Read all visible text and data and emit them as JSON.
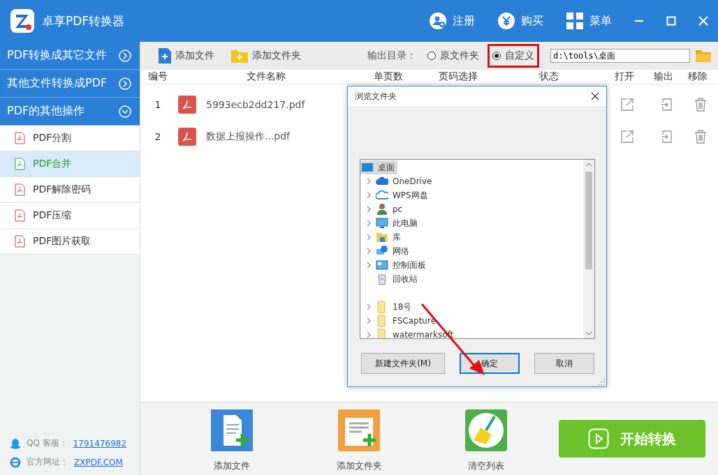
{
  "window": {
    "title": "卓享PDF转换器",
    "actions": [
      {
        "kind": "register",
        "label": "注册"
      },
      {
        "kind": "buy",
        "label": "购买"
      },
      {
        "kind": "menu",
        "label": "菜单"
      }
    ]
  },
  "sidebar": {
    "groups": [
      {
        "label": "PDF转换成其它文件",
        "expanded": false
      },
      {
        "label": "其他文件转换成PDF",
        "expanded": false
      },
      {
        "label": "PDF的其他操作",
        "expanded": true,
        "items": [
          {
            "label": "PDF分割",
            "selected": false
          },
          {
            "label": "PDF合并",
            "selected": true
          },
          {
            "label": "PDF解除密码",
            "selected": false
          },
          {
            "label": "PDF压缩",
            "selected": false
          },
          {
            "label": "PDF图片获取",
            "selected": false
          }
        ]
      }
    ],
    "contacts": [
      {
        "kind": "qq",
        "label": "QQ 客服：",
        "link": "1791476982"
      },
      {
        "kind": "web",
        "label": "官方网址：",
        "link": "ZXPDF.COM"
      }
    ]
  },
  "toolbar": {
    "add_file": "添加文件",
    "add_folder": "添加文件夹",
    "output_label": "输出目录：",
    "options": [
      {
        "label": "原文件夹",
        "selected": false,
        "highlighted": false
      },
      {
        "label": "自定义",
        "selected": true,
        "highlighted": true
      }
    ],
    "path": "d:\\tools\\桌面"
  },
  "table": {
    "columns": [
      "编号",
      "文件名称",
      "单页数",
      "页码选择",
      "状态",
      "打开",
      "输出",
      "移除"
    ],
    "rows": [
      {
        "index": "1",
        "name": "5993ecb2dd217.pdf"
      },
      {
        "index": "2",
        "name": "数据上报操作...pdf"
      }
    ]
  },
  "dialog": {
    "title": "浏览文件夹",
    "tree": {
      "label": "桌面",
      "selected": true,
      "children": [
        {
          "label": "OneDrive",
          "kind": "cloud",
          "expandable": true
        },
        {
          "label": "WPS网盘",
          "kind": "netdisk",
          "expandable": true
        },
        {
          "label": "pc",
          "kind": "user",
          "expandable": true
        },
        {
          "label": "此电脑",
          "kind": "computer",
          "expandable": true
        },
        {
          "label": "库",
          "kind": "library",
          "expandable": true
        },
        {
          "label": "网络",
          "kind": "network",
          "expandable": true
        },
        {
          "label": "控制面板",
          "kind": "panel",
          "expandable": true
        },
        {
          "label": "回收站",
          "kind": "bin",
          "expandable": false
        },
        {
          "label": "18号",
          "kind": "folder",
          "expandable": true
        },
        {
          "label": "FSCapture",
          "kind": "folder",
          "expandable": true
        },
        {
          "label": "watermarksoft",
          "kind": "folder",
          "expandable": true
        }
      ]
    },
    "buttons": [
      {
        "label": "新建文件夹(M)",
        "selected": false
      },
      {
        "label": "确定",
        "selected": true
      },
      {
        "label": "取消",
        "selected": false
      }
    ]
  },
  "bottom": {
    "actions": [
      {
        "kind": "file",
        "label": "添加文件"
      },
      {
        "kind": "folder",
        "label": "添加文件夹"
      },
      {
        "kind": "clear",
        "label": "清空列表"
      }
    ],
    "start": "开始转换"
  }
}
